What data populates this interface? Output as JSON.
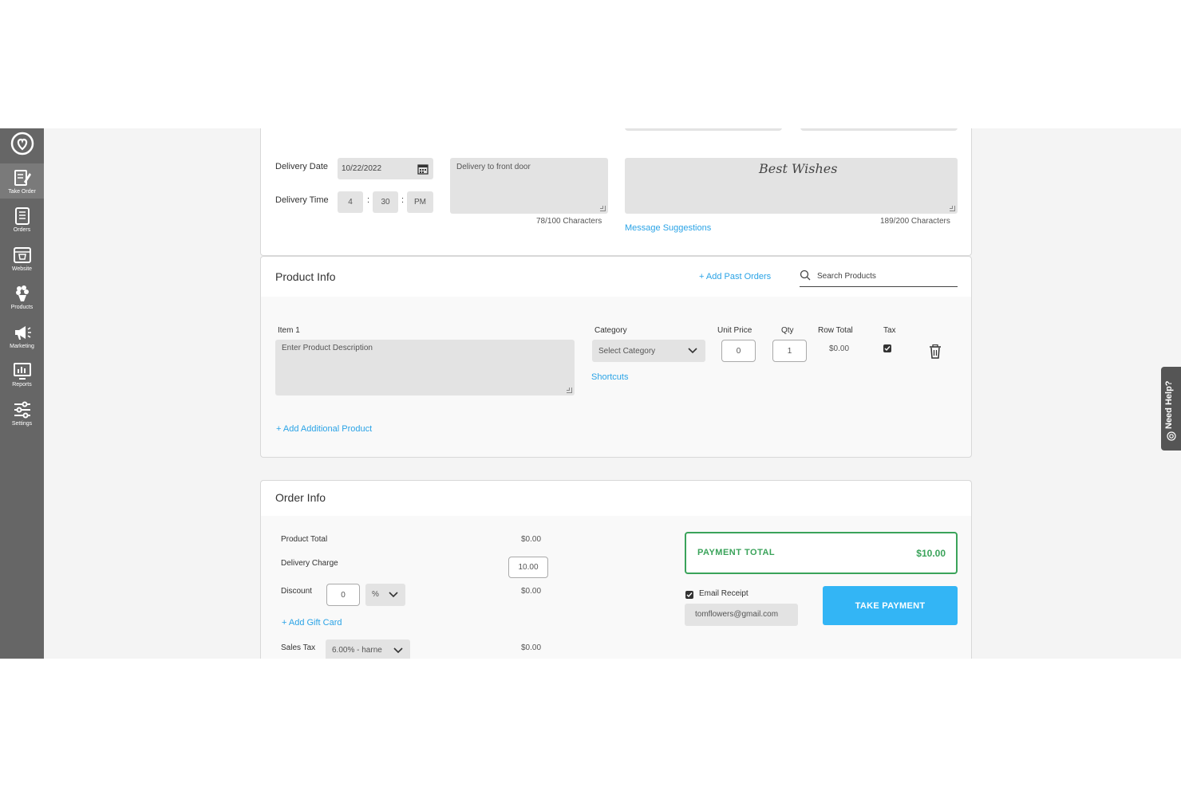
{
  "sidebar": {
    "logo_icon": "heart-circle-logo-icon",
    "items": [
      {
        "label": "Take Order",
        "icon": "take-order-icon"
      },
      {
        "label": "Orders",
        "icon": "orders-icon"
      },
      {
        "label": "Website",
        "icon": "website-icon"
      },
      {
        "label": "Products",
        "icon": "products-icon"
      },
      {
        "label": "Marketing",
        "icon": "megaphone-icon"
      },
      {
        "label": "Reports",
        "icon": "reports-icon"
      },
      {
        "label": "Settings",
        "icon": "sliders-icon"
      }
    ]
  },
  "delivery": {
    "date_label": "Delivery Date",
    "date_value": "10/22/2022",
    "time_label": "Delivery Time",
    "hour": "4",
    "minute": "30",
    "ampm": "PM",
    "instructions": "Delivery to front door",
    "instructions_count": "78/100 Characters",
    "card_message": "Best Wishes",
    "message_suggestions": "Message Suggestions",
    "message_count": "189/200 Characters"
  },
  "product_info": {
    "title": "Product Info",
    "add_past_orders": "+ Add Past Orders",
    "search_placeholder": "Search Products",
    "item_label": "Item 1",
    "description_placeholder": "Enter Product Description",
    "category_label": "Category",
    "category_value": "Select Category",
    "shortcuts": "Shortcuts",
    "unit_price_label": "Unit Price",
    "unit_price": "0",
    "qty_label": "Qty",
    "qty": "1",
    "row_total_label": "Row Total",
    "row_total": "$0.00",
    "tax_label": "Tax",
    "tax_checked": true,
    "add_additional": "+ Add Additional Product"
  },
  "order_info": {
    "title": "Order Info",
    "product_total_label": "Product Total",
    "product_total": "$0.00",
    "delivery_charge_label": "Delivery Charge",
    "delivery_charge": "10.00",
    "discount_label": "Discount",
    "discount_value": "0",
    "discount_type": "%",
    "discount_amount": "$0.00",
    "add_gift_card": "+ Add Gift Card",
    "sales_tax_label": "Sales Tax",
    "sales_tax_value": "6.00% - harne",
    "sales_tax_amount": "$0.00",
    "payment_total_label": "PAYMENT TOTAL",
    "payment_total": "$10.00",
    "email_receipt_label": "Email Receipt",
    "email_receipt_checked": true,
    "email": "tomflowers@gmail.com",
    "take_payment": "TAKE PAYMENT"
  },
  "help": {
    "label": "Need Help?"
  },
  "colors": {
    "sidebar": "#666666",
    "accent": "#2aa3e6",
    "button": "#33b5f5",
    "payment_green": "#3aa35a"
  }
}
